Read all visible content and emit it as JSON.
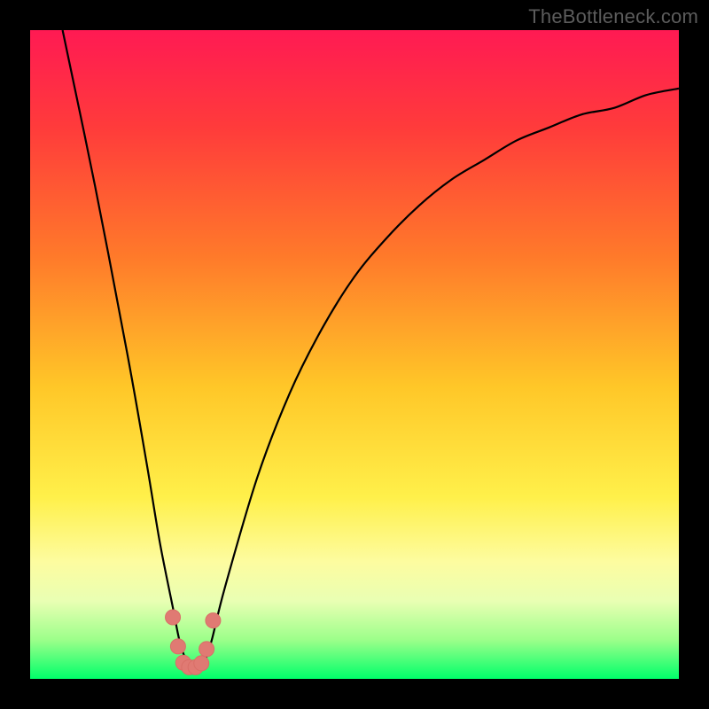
{
  "watermark": "TheBottleneck.com",
  "colors": {
    "black": "#000000",
    "curve": "#000000",
    "marker_fill": "#e07a73",
    "marker_stroke": "#d96e67",
    "gradient_stops": [
      {
        "offset": 0.0,
        "color": "#ff1a53"
      },
      {
        "offset": 0.15,
        "color": "#ff3b3b"
      },
      {
        "offset": 0.35,
        "color": "#ff7a2a"
      },
      {
        "offset": 0.55,
        "color": "#ffc728"
      },
      {
        "offset": 0.72,
        "color": "#fff04a"
      },
      {
        "offset": 0.82,
        "color": "#fdfca0"
      },
      {
        "offset": 0.88,
        "color": "#e9ffb3"
      },
      {
        "offset": 0.94,
        "color": "#9cff8a"
      },
      {
        "offset": 1.0,
        "color": "#00ff6a"
      }
    ]
  },
  "chart_data": {
    "type": "line",
    "title": "",
    "xlabel": "",
    "ylabel": "",
    "xlim": [
      0,
      100
    ],
    "ylim": [
      0,
      100
    ],
    "series": [
      {
        "name": "bottleneck-curve",
        "x": [
          5,
          10,
          15,
          18,
          20,
          22,
          23,
          24,
          25,
          26,
          27,
          28,
          30,
          35,
          40,
          45,
          50,
          55,
          60,
          65,
          70,
          75,
          80,
          85,
          90,
          95,
          100
        ],
        "values": [
          100,
          76,
          50,
          33,
          21,
          11,
          6,
          3,
          2,
          2,
          3,
          6,
          14,
          31,
          44,
          54,
          62,
          68,
          73,
          77,
          80,
          83,
          85,
          87,
          88,
          90,
          91
        ]
      }
    ],
    "markers": {
      "name": "highlighted-points",
      "x": [
        22.0,
        22.8,
        23.6,
        24.5,
        25.5,
        26.4,
        27.2,
        28.2
      ],
      "values": [
        9.5,
        5.0,
        2.5,
        1.8,
        1.8,
        2.4,
        4.6,
        9.0
      ]
    }
  }
}
